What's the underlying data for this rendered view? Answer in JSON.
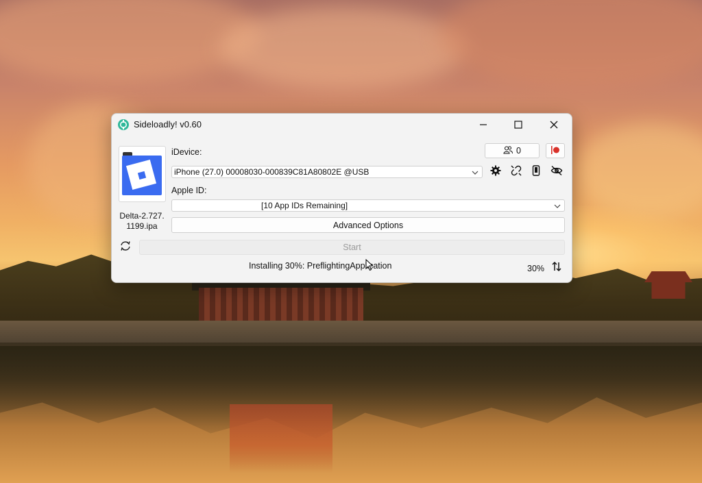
{
  "window": {
    "title": "Sideloadly! v0.60"
  },
  "app": {
    "name": "Delta-2.727.\n1199.ipa"
  },
  "idevice": {
    "label": "iDevice:",
    "selected": "iPhone (27.0) 00008030-000839C81A80802E @USB"
  },
  "apple_id": {
    "label": "Apple ID:",
    "selected": "[10 App IDs Remaining]"
  },
  "buttons": {
    "accounts_count": "0",
    "advanced_options": "Advanced Options",
    "start": "Start"
  },
  "status": {
    "message": "Installing 30%: PreflightingApplication",
    "progress_text": "30%",
    "progress": 0.3
  },
  "icons": {
    "app": "sideloadly-logo-icon",
    "accounts": "users-icon",
    "record": "record-icon",
    "settings": "gear-icon",
    "unlink": "unlink-icon",
    "device": "phone-icon",
    "hide": "eye-off-icon",
    "refresh": "refresh-icon",
    "log": "sort-arrows-icon"
  },
  "colors": {
    "accent_red": "#d9312a",
    "app_blue": "#3a6bf0"
  }
}
